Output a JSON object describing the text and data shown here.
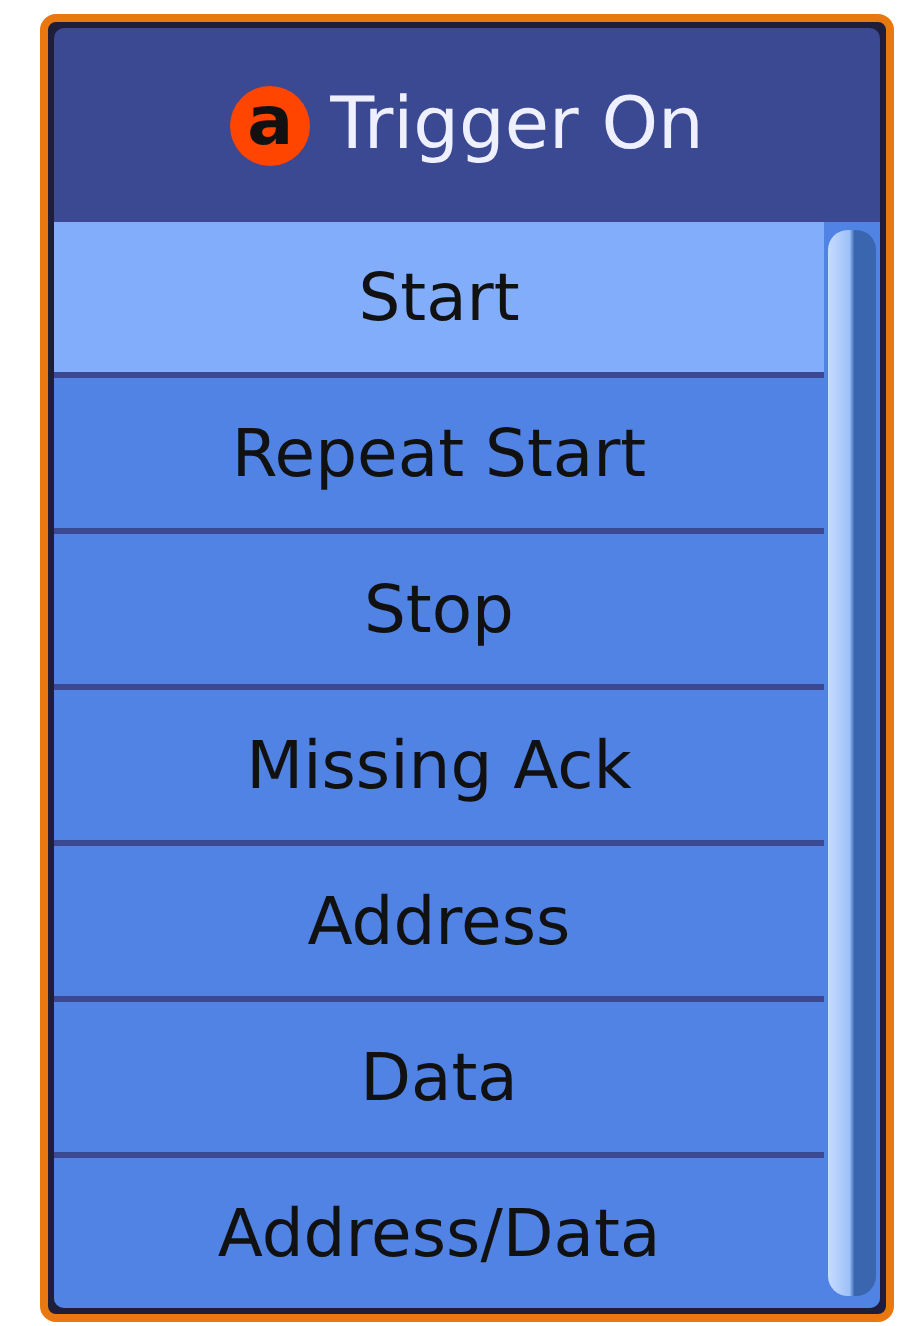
{
  "header": {
    "badge": "a",
    "title": "Trigger On"
  },
  "options": [
    {
      "label": "Start",
      "selected": true
    },
    {
      "label": "Repeat Start",
      "selected": false
    },
    {
      "label": "Stop",
      "selected": false
    },
    {
      "label": "Missing Ack",
      "selected": false
    },
    {
      "label": "Address",
      "selected": false
    },
    {
      "label": "Data",
      "selected": false
    },
    {
      "label": "Address/Data",
      "selected": false
    }
  ]
}
